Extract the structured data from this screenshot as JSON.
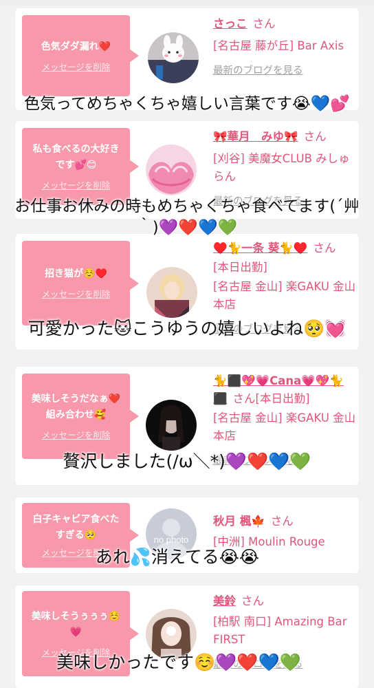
{
  "san": "さん",
  "delete_label": "メッセージを削除",
  "blog_label": "最新のブログを見る",
  "cards": [
    {
      "message": "色気ダダ漏れ❤️",
      "name": "さっこ",
      "shop": "[名古屋 藤が丘] Bar Axis",
      "caption": "色気ってめちゃくちゃ嬉しい言葉です😭💙💕"
    },
    {
      "message": "私も食べるの大好きです💕😊",
      "name": "🎀華月　みゆ🎀",
      "shop": "[刈谷] 美魔女CLUB みしゅらん",
      "caption": "お仕事お休みの時もめちゃくちゃ食べてます(´艸｀)💜❤️💙💚"
    },
    {
      "message": "招き猫が☺️♥️",
      "name": "♥️🐈一条 葵🐈♥️",
      "status": "[本日出勤]",
      "shop": "[名古屋 金山] 楽GAKU 金山本店",
      "caption": "可愛かった🐱こうゆうの嬉しいよね🥺💓"
    },
    {
      "message": "美味しそうだなぁ❤️組み合わせ🥰",
      "name": "🐈⬛💖💗Cana💗💖🐈⬛",
      "status": "[本日出勤]",
      "shop": "[名古屋 金山] 楽GAKU 金山本店",
      "caption": "贅沢しました(/ω＼*)💜❤️💙💚"
    },
    {
      "message": "白子キャビア食べたすぎる🥺",
      "name": "秋月 楓🍁",
      "shop": "[中洲] Moulin Rouge",
      "avatar_text": "no photo",
      "caption": "あれ💦消えてる😭😭"
    },
    {
      "message": "美味しそうぅぅぅ☺️💗",
      "name": "美鈴",
      "shop": "[柏駅 南口] Amazing Bar FIRST",
      "caption": "美味しかったです☺️💜❤️💙💚"
    }
  ],
  "colors": {
    "bubble": "#f799aa",
    "accent": "#e0567a",
    "background": "#f2f2f2"
  }
}
